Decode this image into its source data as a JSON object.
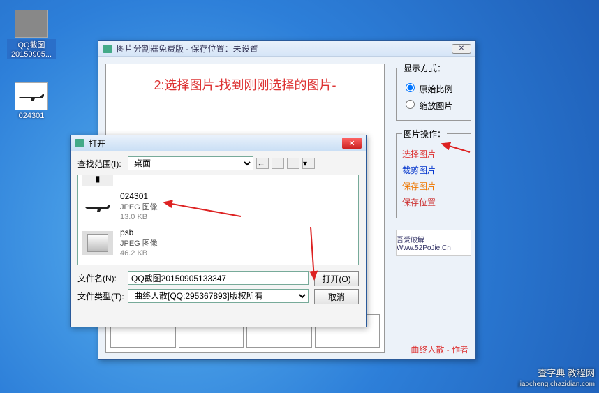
{
  "desktop": {
    "icon1_label": "QQ截图\n20150905...",
    "icon2_label": "024301"
  },
  "main": {
    "title": "图片分割器免费版 - 保存位置：未设置",
    "hint": "2:选择图片-找到刚刚选择的图片-",
    "display_section": "显示方式：",
    "opt_original": "原始比例",
    "opt_scale": "缩放图片",
    "ops_section": "图片操作：",
    "op_select": "选择图片",
    "op_crop": "裁剪图片",
    "op_save": "保存图片",
    "op_location": "保存位置",
    "brand": "吾爱破解\nWww.52PoJie.Cn",
    "author": "曲终人散 - 作者"
  },
  "open": {
    "title": "打开",
    "look_in_label": "查找范围(I):",
    "look_in_value": "桌面",
    "files": [
      {
        "name": "024301",
        "type": "JPEG 图像",
        "size": "13.0 KB",
        "thumb": "gun"
      },
      {
        "name": "psb",
        "type": "JPEG 图像",
        "size": "46.2 KB",
        "thumb": "box"
      }
    ],
    "filename_label": "文件名(N):",
    "filename_value": "QQ截图20150905133347",
    "filetype_label": "文件类型(T):",
    "filetype_value": "曲终人散[QQ:295367893]版权所有",
    "btn_open": "打开(O)",
    "btn_cancel": "取消"
  },
  "watermark": {
    "line1": "查字典 教程网",
    "line2": "jiaocheng.chazidian.com"
  }
}
